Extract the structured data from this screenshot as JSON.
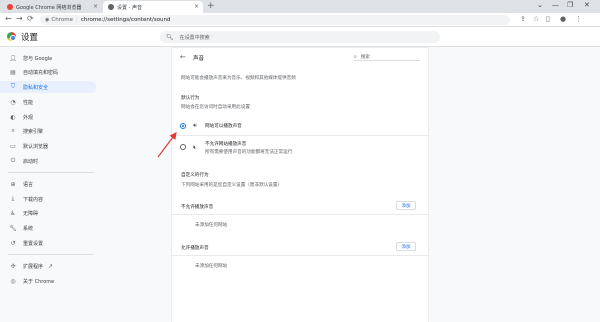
{
  "tabs": [
    {
      "label": "Google Chrome 网络浏览器",
      "favicon_color": "#ea4335"
    },
    {
      "label": "设置 - 声音",
      "favicon_color": "#5f6368"
    }
  ],
  "toolbar": {
    "site_label": "Chrome",
    "url": "chrome://settings/content/sound"
  },
  "header": {
    "title": "设置",
    "search_placeholder": "在设置中搜索"
  },
  "sidebar": {
    "items": [
      {
        "label": "您与 Google",
        "icon": "person-icon"
      },
      {
        "label": "自动填充和密码",
        "icon": "clipboard-icon"
      },
      {
        "label": "隐私和安全",
        "icon": "shield-icon",
        "active": true
      },
      {
        "label": "性能",
        "icon": "speedometer-icon"
      },
      {
        "label": "外观",
        "icon": "palette-icon"
      },
      {
        "label": "搜索引擎",
        "icon": "search-icon"
      },
      {
        "label": "默认浏览器",
        "icon": "browser-icon"
      },
      {
        "label": "启动时",
        "icon": "power-icon"
      },
      {
        "label": "语言",
        "icon": "globe-icon"
      },
      {
        "label": "下载内容",
        "icon": "download-icon"
      },
      {
        "label": "无障碍",
        "icon": "accessibility-icon"
      },
      {
        "label": "系统",
        "icon": "wrench-icon"
      },
      {
        "label": "重置设置",
        "icon": "reset-icon"
      },
      {
        "label": "扩展程序",
        "icon": "puzzle-icon"
      },
      {
        "label": "关于 Chrome",
        "icon": "chrome-icon"
      }
    ]
  },
  "sound": {
    "title": "声音",
    "search_placeholder": "搜索",
    "description": "网站可能会播放声音来为音乐、视频和其他媒体提供音频",
    "default_heading": "默认行为",
    "default_sub": "网站会在您访问时自动采用此设置",
    "options": [
      {
        "label": "网站可以播放声音",
        "selected": true
      },
      {
        "label": "不允许网站播放声音",
        "sub": "所有需要使用声音的功能都将无法正常运行",
        "selected": false
      }
    ],
    "custom_heading": "自定义的行为",
    "custom_sub": "下列网站采用的是您自定义设置（而非默认设置）",
    "blocked_label": "不允许播放声音",
    "blocked_empty": "未添加任何网站",
    "allowed_label": "允许播放声音",
    "allowed_empty": "未添加任何网站",
    "add_label": "添加"
  },
  "colors": {
    "accent": "#1a73e8",
    "annotation_arrow": "#e53935"
  }
}
